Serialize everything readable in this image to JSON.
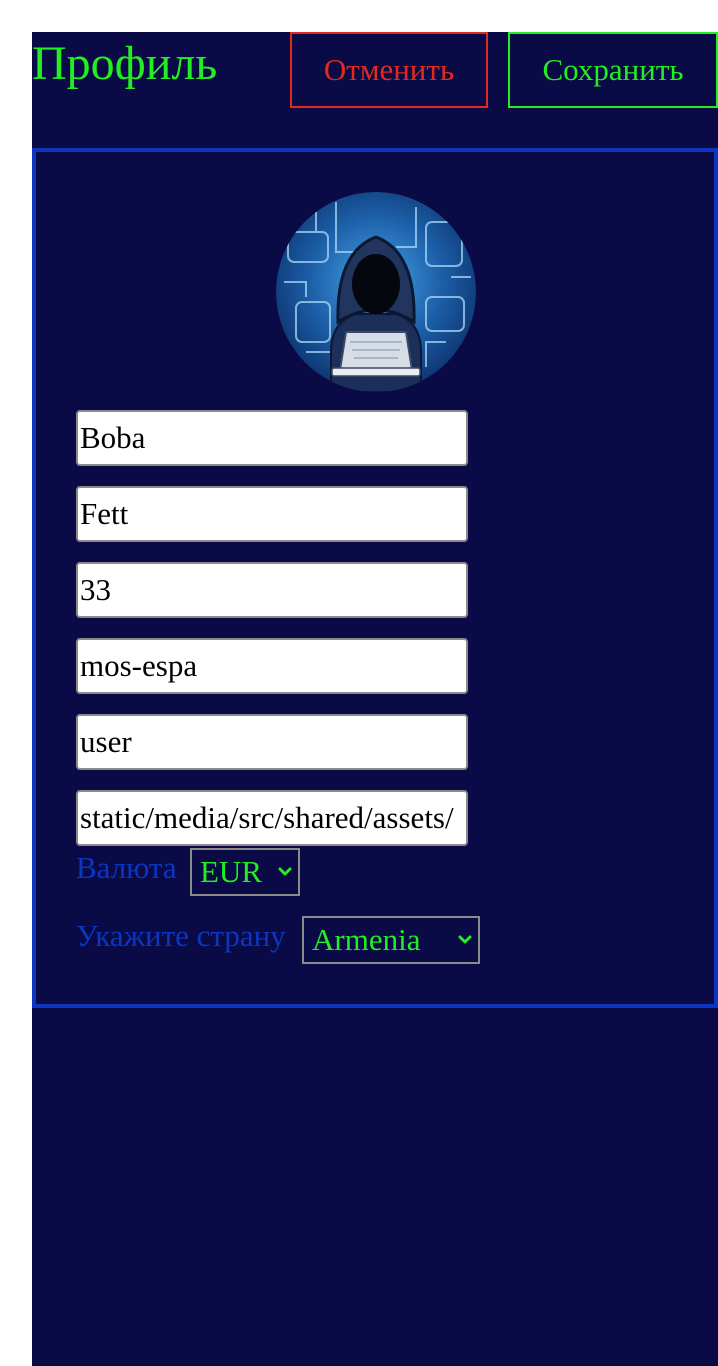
{
  "header": {
    "title": "Профиль",
    "cancel_label": "Отменить",
    "save_label": "Сохранить"
  },
  "profile": {
    "first_name": "Boba",
    "last_name": "Fett",
    "age": "33",
    "city": "mos-espa",
    "role": "user",
    "avatar_path": "static/media/src/shared/assets/"
  },
  "currency": {
    "label": "Валюта",
    "selected": "EUR"
  },
  "country": {
    "label": "Укажите страну",
    "selected": "Armenia"
  },
  "icons": {
    "avatar": "hooded-hacker-avatar",
    "chevron": "chevron-down-icon"
  },
  "colors": {
    "background": "#0a0a46",
    "accent_green": "#22ee22",
    "cancel_red": "#e22a1e",
    "card_border": "#0a36c0"
  }
}
